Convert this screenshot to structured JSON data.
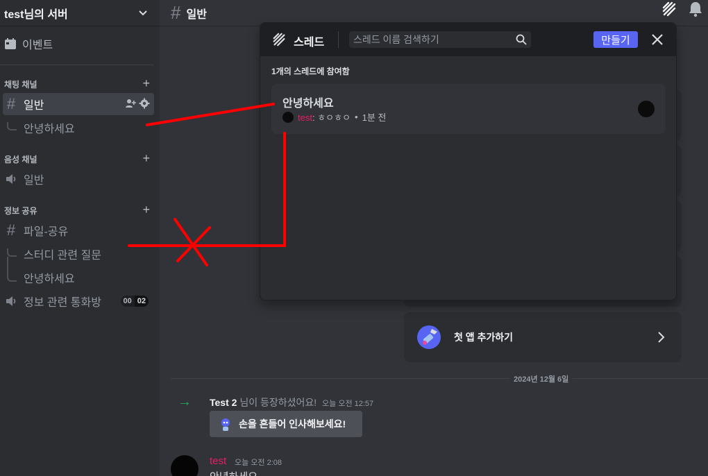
{
  "sidebar": {
    "server_name": "test님의 서버",
    "events_label": "이벤트",
    "categories": {
      "text": "채팅 채널",
      "voice": "음성 채널",
      "info": "정보 공유"
    },
    "channels": {
      "general": "일반",
      "thread_hello": "안녕하세요",
      "voice_general": "일반",
      "file_share": "파일-공유",
      "study_question": "스터디 관련 질문",
      "thread_hello2": "안녕하세요",
      "voice_info": "정보 관련 통화방",
      "voice_info_badge_left": "00",
      "voice_info_badge_right": "02"
    }
  },
  "main": {
    "channel_name": "일반",
    "first_app_label": "첫 앱 추가하기",
    "date_divider": "2024년 12월 6일",
    "join": {
      "name": "Test 2",
      "text": "님이 등장하셨어요!",
      "time": "오늘 오전 12:57",
      "wave_label": "손을 흔들어 인사해보세요!"
    },
    "message": {
      "author": "test",
      "time": "오늘 오전 2:08",
      "text": "안녕하세요"
    }
  },
  "threads_popout": {
    "title": "스레드",
    "search_placeholder": "스레드 이름 검색하기",
    "create_label": "만들기",
    "joined_count": "1개의 스레드에 참여함",
    "thread": {
      "name": "안녕하세요",
      "author": "test",
      "preview": ": ㅎㅇㅎㅇ",
      "dot": "•",
      "age": "1분 전"
    }
  },
  "colors": {
    "accent": "#5865f2",
    "author_pink": "#e91e63",
    "annotation_red": "#ff0000",
    "join_green": "#23a55a"
  }
}
